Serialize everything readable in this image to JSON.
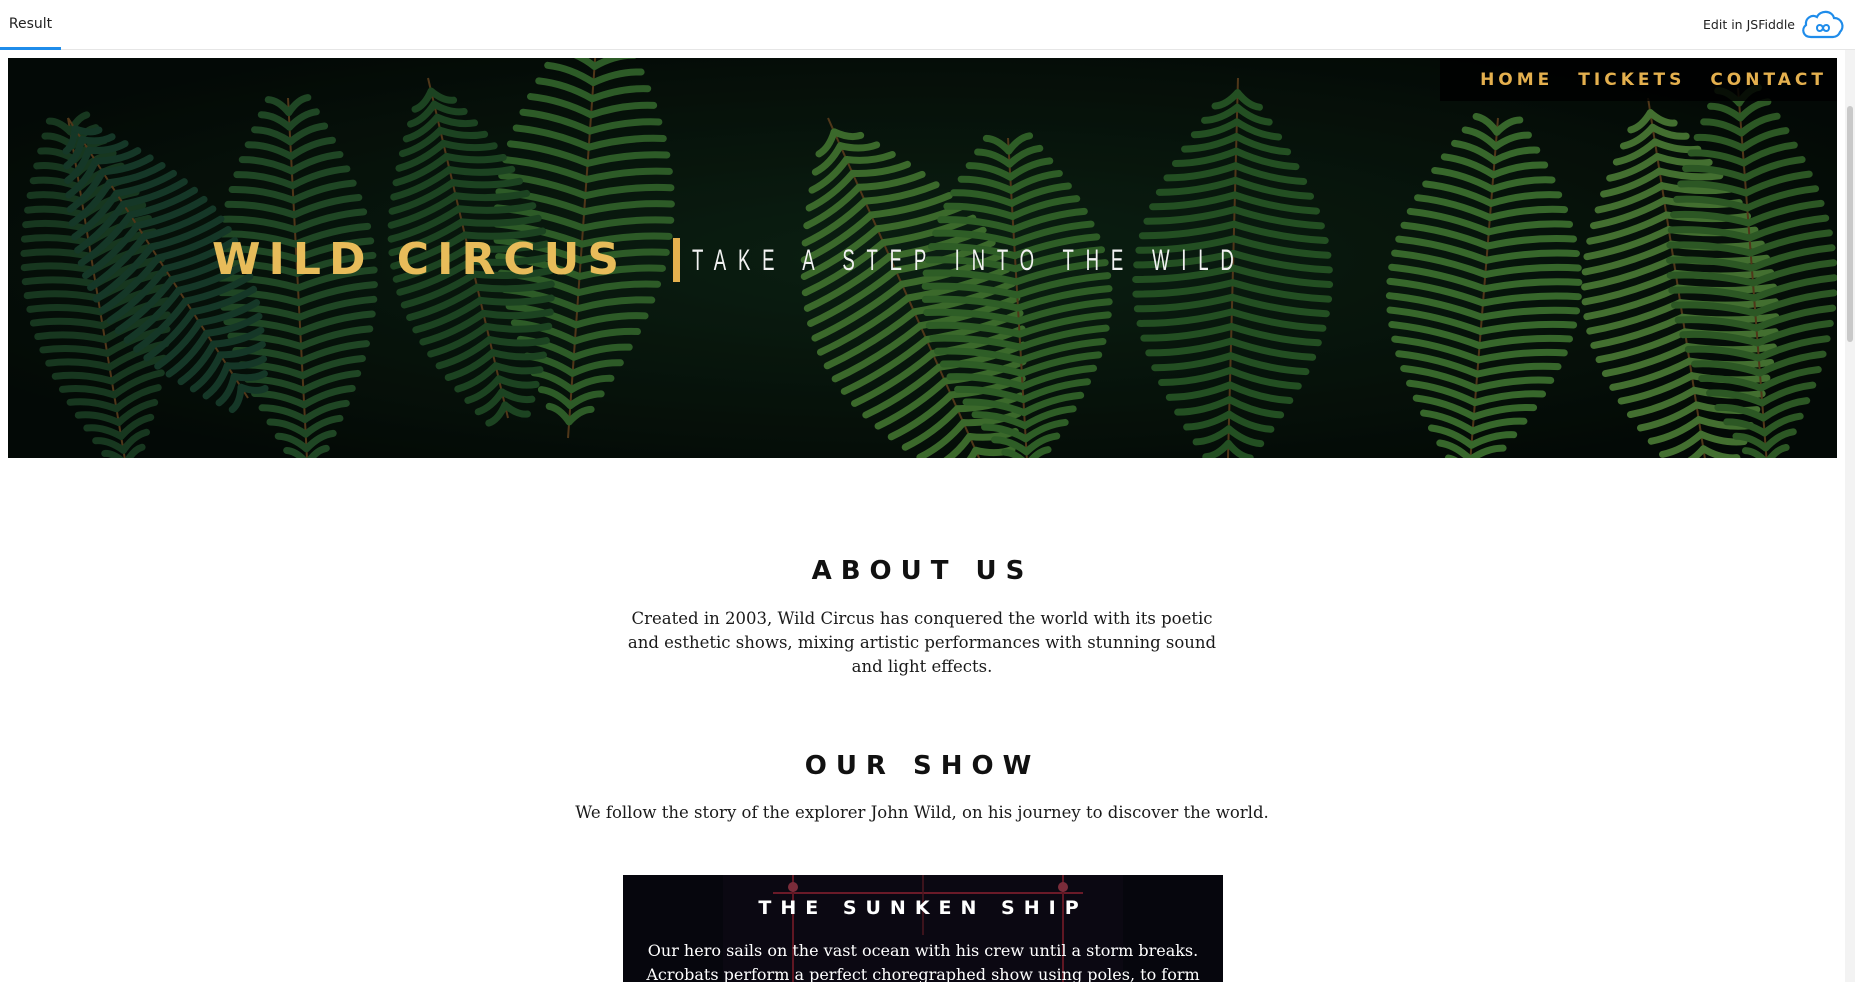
{
  "fiddle": {
    "tab_label": "Result",
    "edit_label": "Edit in JSFiddle",
    "cloud_icon": "jsfiddle-cloud-icon",
    "accent": "#1f8cea"
  },
  "nav": {
    "items": [
      {
        "label": "HOME"
      },
      {
        "label": "TICKETS"
      },
      {
        "label": "CONTACT"
      }
    ],
    "color": "#e4b04e"
  },
  "hero": {
    "title": "WILD CIRCUS",
    "tagline": "TAKE A STEP INTO THE WILD",
    "title_color": "#e8bc5a"
  },
  "about": {
    "title": "ABOUT US",
    "text": "Created in 2003, Wild Circus has conquered the world with its poetic and esthetic shows, mixing artistic performances with stunning sound and light effects."
  },
  "show": {
    "title": "OUR SHOW",
    "text": "We follow the story of the explorer John Wild, on his journey to discover the world.",
    "card": {
      "title": "THE SUNKEN SHIP",
      "text": "Our hero sails on the vast ocean with his crew until a storm breaks. Acrobats perform a perfect choregraphed show using poles, to form a human ship."
    }
  }
}
